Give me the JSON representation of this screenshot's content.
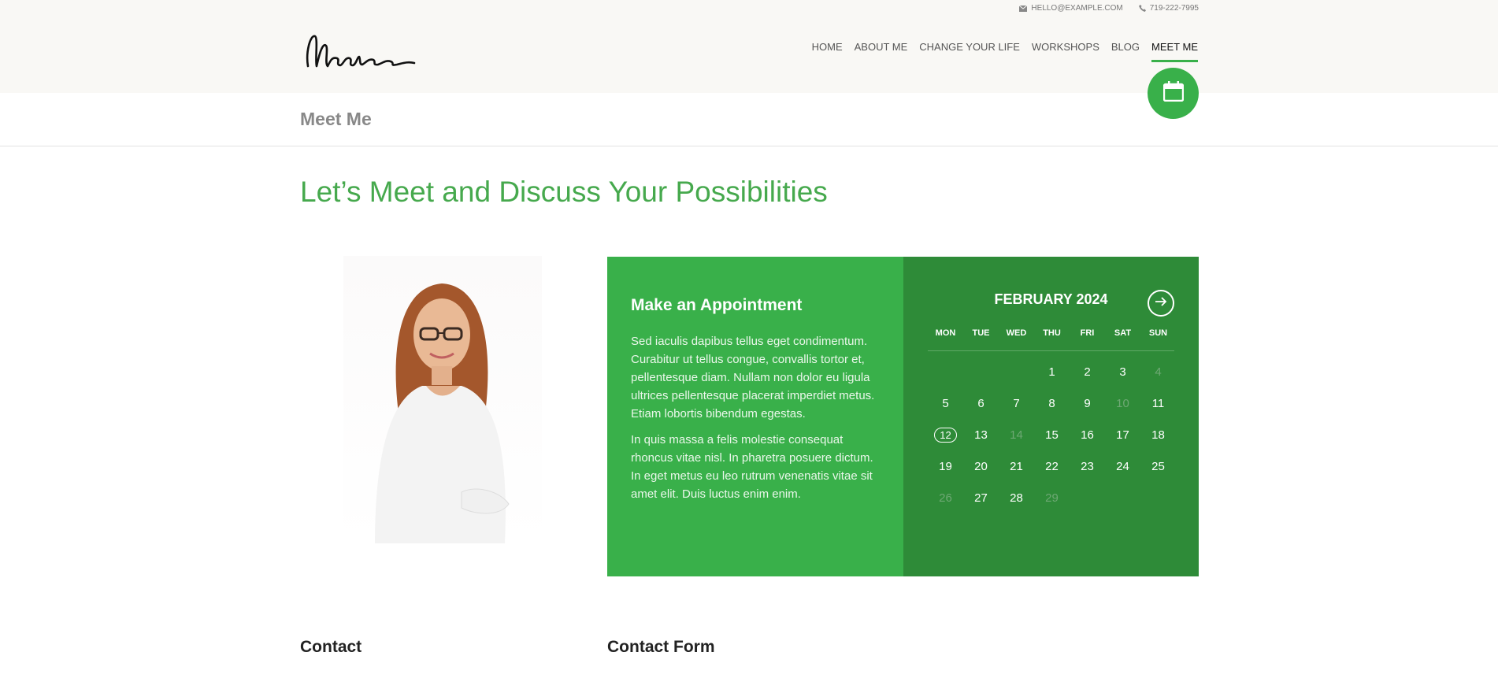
{
  "topbar": {
    "email": "HELLO@EXAMPLE.COM",
    "email_icon": "envelope-icon",
    "phone": "719-222-7995",
    "phone_icon": "phone-icon"
  },
  "logo": {
    "text": "Mehra"
  },
  "nav": {
    "items": [
      {
        "label": "HOME"
      },
      {
        "label": "ABOUT ME"
      },
      {
        "label": "CHANGE YOUR LIFE"
      },
      {
        "label": "WORKSHOPS"
      },
      {
        "label": "BLOG"
      },
      {
        "label": "MEET ME",
        "active": true
      }
    ]
  },
  "page": {
    "title": "Meet Me",
    "headline": "Let’s Meet and Discuss Your Possibilities"
  },
  "appointment": {
    "title": "Make an Appointment",
    "para1": "Sed iaculis dapibus tellus eget condimentum. Curabitur ut tellus congue, convallis tortor et, pellentesque diam. Nullam non dolor eu ligula ultrices pellentesque placerat imperdiet metus. Etiam lobortis bibendum egestas.",
    "para2": "In quis massa a felis molestie consequat rhoncus vitae nisl. In pharetra posuere dictum. In eget metus eu leo rutrum venenatis vitae sit amet elit. Duis luctus enim enim."
  },
  "calendar": {
    "month": "FEBRUARY 2024",
    "weekdays": [
      "MON",
      "TUE",
      "WED",
      "THU",
      "FRI",
      "SAT",
      "SUN"
    ],
    "days": [
      {
        "d": ""
      },
      {
        "d": ""
      },
      {
        "d": ""
      },
      {
        "d": "1"
      },
      {
        "d": "2"
      },
      {
        "d": "3"
      },
      {
        "d": "4",
        "muted": true
      },
      {
        "d": "5"
      },
      {
        "d": "6"
      },
      {
        "d": "7"
      },
      {
        "d": "8"
      },
      {
        "d": "9"
      },
      {
        "d": "10",
        "muted": true
      },
      {
        "d": "11"
      },
      {
        "d": "12",
        "today": true
      },
      {
        "d": "13"
      },
      {
        "d": "14",
        "muted": true
      },
      {
        "d": "15"
      },
      {
        "d": "16"
      },
      {
        "d": "17"
      },
      {
        "d": "18"
      },
      {
        "d": "19"
      },
      {
        "d": "20"
      },
      {
        "d": "21"
      },
      {
        "d": "22"
      },
      {
        "d": "23"
      },
      {
        "d": "24"
      },
      {
        "d": "25"
      },
      {
        "d": "26",
        "muted": true
      },
      {
        "d": "27"
      },
      {
        "d": "28"
      },
      {
        "d": "29",
        "muted": true
      }
    ]
  },
  "sections": {
    "contact": "Contact",
    "contact_form": "Contact Form"
  },
  "colors": {
    "accent": "#39b04a",
    "accent_dark": "#2e8b38",
    "header_bg": "#f9f8f5"
  }
}
